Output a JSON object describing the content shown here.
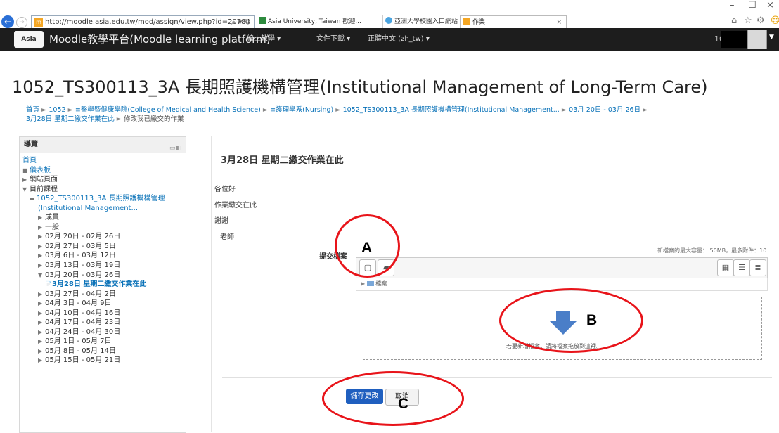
{
  "browser": {
    "url": "http://moodle.asia.edu.tw/mod/assign/view.php?id=20784",
    "tabs": [
      {
        "label": "Asia University, Taiwan 歡迎..."
      },
      {
        "label": "亞洲大學校園入口網站 | Asia ..."
      },
      {
        "label": "作業"
      }
    ],
    "window_controls": {
      "minimize": "–",
      "maximize": "☐",
      "close": "×"
    }
  },
  "navbar": {
    "brand": "Moodle教學平台(Moodle learning platform)",
    "menus": [
      "線上教學 ▾",
      "文件下載 ▾",
      "正體中文 (zh_tw) ▾"
    ],
    "user_text": "10"
  },
  "page": {
    "title": "1052_TS300113_3A 長期照護機構管理(Institutional Management of Long-Term Care)",
    "breadcrumb": [
      "首頁",
      "1052",
      "≡醫學暨健康學院(College of Medical and Health Science)",
      "≡護理學系(Nursing)",
      "1052_TS300113_3A 長期照護機構管理(Institutional Management...",
      "03月 20日 - 03月 26日",
      "3月28日 星期二繳交作業在此",
      "修改我已繳交的作業"
    ]
  },
  "sidebar": {
    "title": "導覽",
    "items": [
      {
        "label": "首頁",
        "icon": "",
        "indent": 1,
        "link": true
      },
      {
        "label": "儀表板",
        "icon": "■",
        "indent": 1,
        "link": true
      },
      {
        "label": "網站頁面",
        "icon": "▶",
        "indent": 1,
        "link": false
      },
      {
        "label": "目前課程",
        "icon": "▼",
        "indent": 1,
        "link": false
      },
      {
        "label": "1052_TS300113_3A 長期照護機構管理",
        "icon": "▬",
        "indent": 2,
        "link": true
      },
      {
        "label": "(Institutional Management...",
        "icon": "",
        "indent": 3,
        "link": true
      },
      {
        "label": "成員",
        "icon": "▶",
        "indent": 3,
        "link": false
      },
      {
        "label": "一般",
        "icon": "▶",
        "indent": 3,
        "link": false
      },
      {
        "label": "02月 20日 - 02月 26日",
        "icon": "▶",
        "indent": 3,
        "link": false
      },
      {
        "label": "02月 27日 - 03月 5日",
        "icon": "▶",
        "indent": 3,
        "link": false
      },
      {
        "label": "03月 6日 - 03月 12日",
        "icon": "▶",
        "indent": 3,
        "link": false
      },
      {
        "label": "03月 13日 - 03月 19日",
        "icon": "▶",
        "indent": 3,
        "link": false
      },
      {
        "label": "03月 20日 - 03月 26日",
        "icon": "▼",
        "indent": 3,
        "link": false
      },
      {
        "label": "3月28日 星期二繳交作業在此",
        "icon": "📄",
        "indent": 4,
        "link": true,
        "current": true
      },
      {
        "label": "03月 27日 - 04月 2日",
        "icon": "▶",
        "indent": 3,
        "link": false
      },
      {
        "label": "04月 3日 - 04月 9日",
        "icon": "▶",
        "indent": 3,
        "link": false
      },
      {
        "label": "04月 10日 - 04月 16日",
        "icon": "▶",
        "indent": 3,
        "link": false
      },
      {
        "label": "04月 17日 - 04月 23日",
        "icon": "▶",
        "indent": 3,
        "link": false
      },
      {
        "label": "04月 24日 - 04月 30日",
        "icon": "▶",
        "indent": 3,
        "link": false
      },
      {
        "label": "05月 1日 - 05月 7日",
        "icon": "▶",
        "indent": 3,
        "link": false
      },
      {
        "label": "05月 8日 - 05月 14日",
        "icon": "▶",
        "indent": 3,
        "link": false
      },
      {
        "label": "05月 15日 - 05月 21日",
        "icon": "▶",
        "indent": 3,
        "link": false
      }
    ]
  },
  "main": {
    "heading": "3月28日 星期二繳交作業在此",
    "intro": [
      "各位好",
      "作業繳交在此",
      "謝謝",
      "老師"
    ],
    "submit_label": "提交檔案",
    "max_info": "新檔案的最大容量： 50MB，最多附件：10",
    "path_label": "檔案",
    "drop_text": "若要新增檔案，請將檔案拖放到這裡。",
    "save_label": "儲存更改",
    "cancel_label": "取消"
  },
  "annotations": {
    "a": "A",
    "b": "B",
    "c": "C",
    "ring_color": "#e8141a"
  },
  "colors": {
    "navbar": "#1d1d1d",
    "link": "#0a72b8",
    "primary_button": "#1f5fbf"
  }
}
